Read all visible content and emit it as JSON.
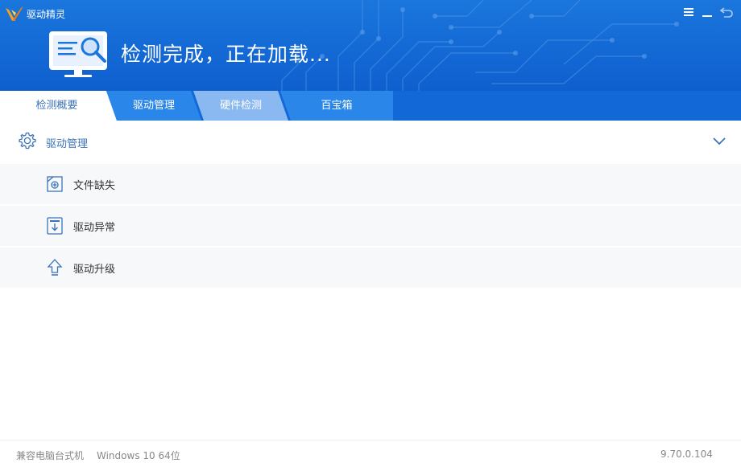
{
  "app": {
    "title": "驱动精灵"
  },
  "header": {
    "status": "检测完成，正在加载..."
  },
  "tabs": [
    {
      "label": "检测概要",
      "state": "active"
    },
    {
      "label": "驱动管理",
      "state": "normal"
    },
    {
      "label": "硬件检测",
      "state": "light"
    },
    {
      "label": "百宝箱",
      "state": "normal"
    }
  ],
  "section": {
    "title": "驱动管理"
  },
  "items": [
    {
      "label": "文件缺失",
      "icon": "file-missing-icon"
    },
    {
      "label": "驱动异常",
      "icon": "driver-error-icon"
    },
    {
      "label": "驱动升级",
      "icon": "upgrade-arrow-icon"
    }
  ],
  "footer": {
    "machine": "兼容电脑台式机",
    "os": "Windows 10 64位",
    "version": "9.70.0.104"
  },
  "colors": {
    "header_blue": "#1a76dc",
    "tab_blue": "#1368d8",
    "tab_light": "#8ab8f0",
    "accent": "#3b73b9"
  }
}
